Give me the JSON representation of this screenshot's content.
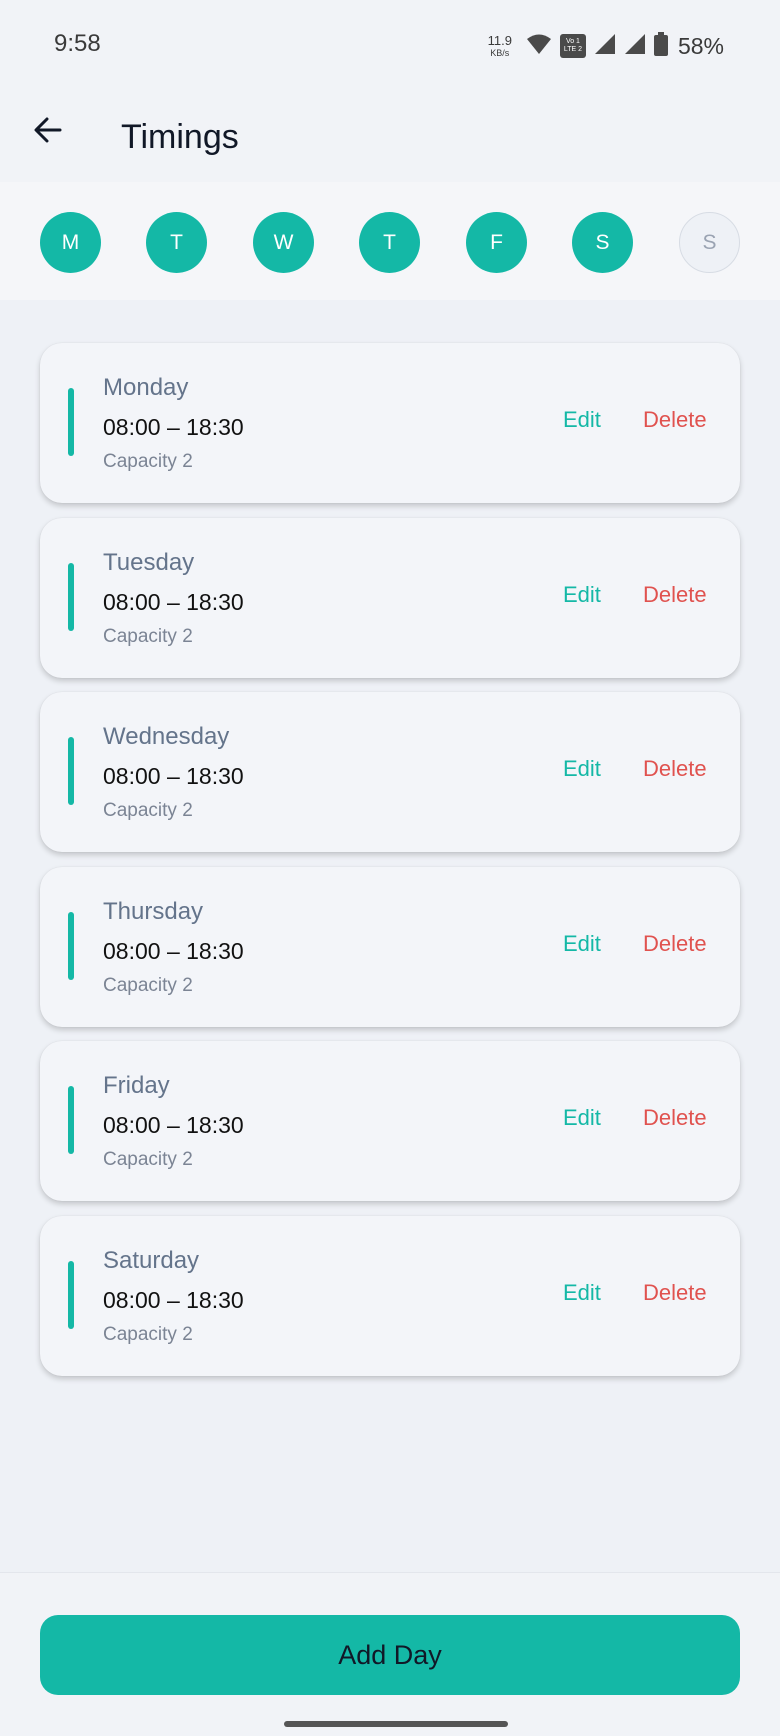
{
  "status_bar": {
    "time": "9:58",
    "net_speed": "11.9",
    "net_unit": "KB/s",
    "volte_top": "Vo 1",
    "volte_bottom": "LTE 2",
    "battery": "58%"
  },
  "header": {
    "title": "Timings"
  },
  "day_selector": [
    {
      "label": "M",
      "active": true
    },
    {
      "label": "T",
      "active": true
    },
    {
      "label": "W",
      "active": true
    },
    {
      "label": "T",
      "active": true
    },
    {
      "label": "F",
      "active": true
    },
    {
      "label": "S",
      "active": true
    },
    {
      "label": "S",
      "active": false
    }
  ],
  "timings": [
    {
      "day": "Monday",
      "hours": "08:00 – 18:30",
      "capacity": "Capacity 2"
    },
    {
      "day": "Tuesday",
      "hours": "08:00 – 18:30",
      "capacity": "Capacity 2"
    },
    {
      "day": "Wednesday",
      "hours": "08:00 – 18:30",
      "capacity": "Capacity 2"
    },
    {
      "day": "Thursday",
      "hours": "08:00 – 18:30",
      "capacity": "Capacity 2"
    },
    {
      "day": "Friday",
      "hours": "08:00 – 18:30",
      "capacity": "Capacity 2"
    },
    {
      "day": "Saturday",
      "hours": "08:00 – 18:30",
      "capacity": "Capacity 2"
    }
  ],
  "actions": {
    "edit": "Edit",
    "delete": "Delete"
  },
  "footer": {
    "add_label": "Add Day"
  },
  "colors": {
    "accent": "#14b8a6",
    "danger": "#e0524f",
    "background": "#eef1f6"
  }
}
